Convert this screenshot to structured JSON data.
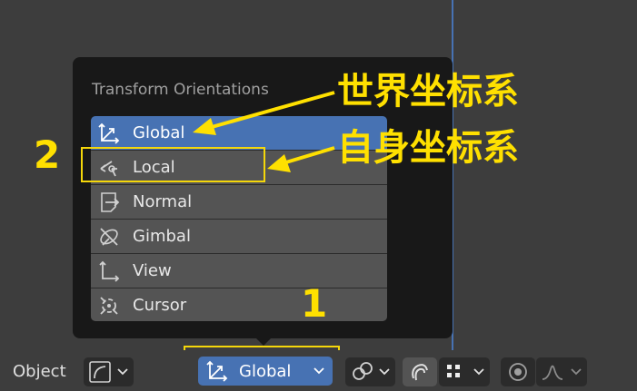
{
  "popup": {
    "title": "Transform Orientations",
    "items": [
      {
        "label": "Global",
        "icon": "global-axes-icon",
        "selected": true
      },
      {
        "label": "Local",
        "icon": "local-axes-icon",
        "selected": false
      },
      {
        "label": "Normal",
        "icon": "normal-icon",
        "selected": false
      },
      {
        "label": "Gimbal",
        "icon": "gimbal-icon",
        "selected": false
      },
      {
        "label": "View",
        "icon": "view-axes-icon",
        "selected": false
      },
      {
        "label": "Cursor",
        "icon": "cursor-icon",
        "selected": false
      }
    ]
  },
  "annotations": {
    "world": "世界坐标系",
    "local": "自身坐标系",
    "num1": "1",
    "num2": "2",
    "color": "#ffe000"
  },
  "toolbar": {
    "mode_label": "Object",
    "orientation_label": "Global"
  },
  "colors": {
    "accent": "#4772b3",
    "background": "#3d3d3d",
    "popup": "#181818",
    "menu_item": "#545454"
  }
}
